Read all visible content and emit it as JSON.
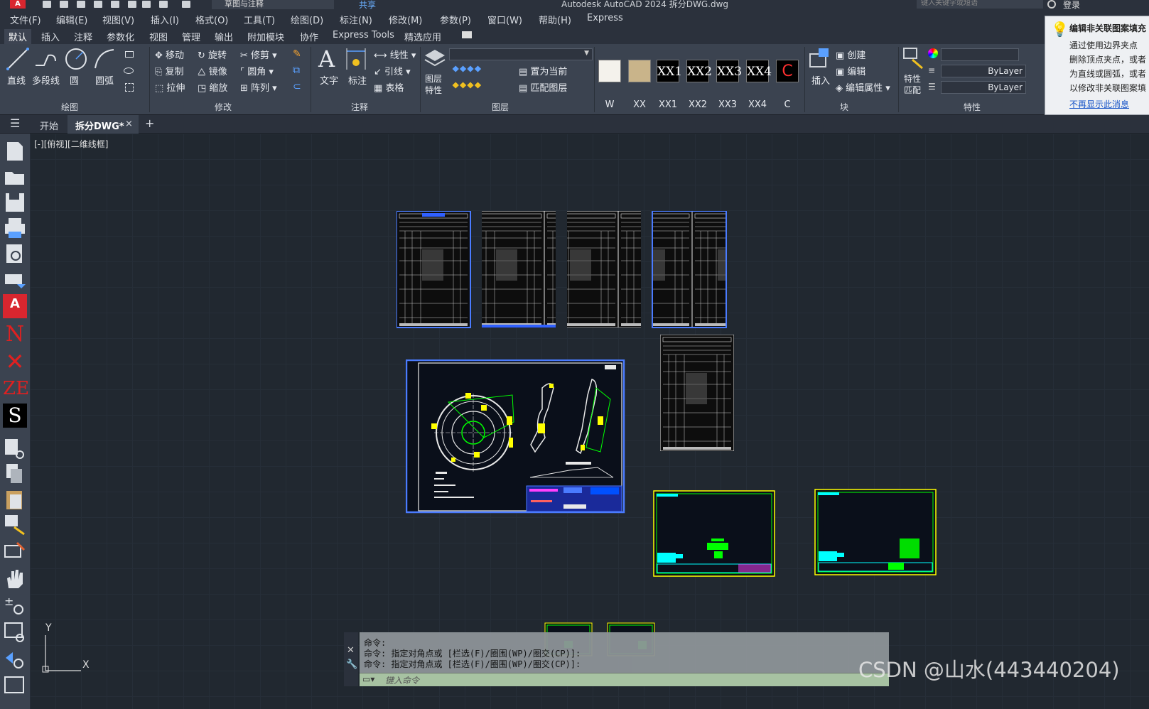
{
  "titlebar": {
    "app_logo": "A",
    "workspace": "草图与注释",
    "share": "共享",
    "title": "Autodesk AutoCAD 2024    拆分DWG.dwg",
    "search_placeholder": "键入关键字或短语",
    "login": "登录"
  },
  "menu": [
    "文件(F)",
    "编辑(E)",
    "视图(V)",
    "插入(I)",
    "格式(O)",
    "工具(T)",
    "绘图(D)",
    "标注(N)",
    "修改(M)",
    "参数(P)",
    "窗口(W)",
    "帮助(H)",
    "Express"
  ],
  "ribbon_tabs": [
    "默认",
    "插入",
    "注释",
    "参数化",
    "视图",
    "管理",
    "输出",
    "附加模块",
    "协作",
    "Express Tools",
    "精选应用"
  ],
  "ribbon": {
    "draw": {
      "title": "绘图",
      "line": "直线",
      "polyline": "多段线",
      "circle": "圆",
      "arc": "圆弧"
    },
    "modify": {
      "title": "修改",
      "move": "移动",
      "rotate": "旋转",
      "trim": "修剪",
      "copy": "复制",
      "mirror": "镜像",
      "fillet": "圆角",
      "stretch": "拉伸",
      "scale": "缩放",
      "array": "阵列"
    },
    "annotation": {
      "title": "注释",
      "text": "文字",
      "dimension": "标注",
      "linear": "线性",
      "leader": "引线",
      "table": "表格"
    },
    "layers": {
      "title": "图层",
      "properties_l1": "图层",
      "properties_l2": "特性",
      "set_current": "置为当前",
      "match_layer": "匹配图层"
    },
    "styles": [
      "W",
      "XX",
      "XX1",
      "XX2",
      "XX3",
      "XX4",
      "C"
    ],
    "block": {
      "title": "块",
      "insert": "插入",
      "create": "创建",
      "edit": "编辑",
      "edit_attributes": "编辑属性"
    },
    "properties": {
      "title": "特性",
      "match_l1": "特性",
      "match_l2": "匹配",
      "bylayer1": "ByLayer",
      "bylayer2": "ByLayer"
    }
  },
  "tooltip": {
    "title": "编辑非关联图案填充",
    "lines": [
      "通过使用边界夹点",
      "删除顶点夹点，或者",
      "为直线或圆弧，或者",
      "以修改非关联图案填"
    ],
    "link": "不再显示此消息"
  },
  "doc_tabs": {
    "start": "开始",
    "active": "拆分DWG*"
  },
  "viewport_label": "[-][俯视][二维线框]",
  "commandline": {
    "lines": [
      "命令:",
      "命令: 指定对角点或 [栏选(F)/圈围(WP)/圈交(CP)]:",
      "命令: 指定对角点或 [栏选(F)/圈围(WP)/圈交(CP)]:"
    ],
    "placeholder": "键入命令"
  },
  "ucs": {
    "x": "X",
    "y": "Y"
  },
  "watermark": "CSDN @山水(443440204)",
  "colors": {
    "canvas": "#212830",
    "ribbon": "#3b4350",
    "selection": "#4a7bff",
    "cad_yellow": "#ffff00",
    "cad_green": "#00ff00",
    "cad_cyan": "#00ffff"
  }
}
